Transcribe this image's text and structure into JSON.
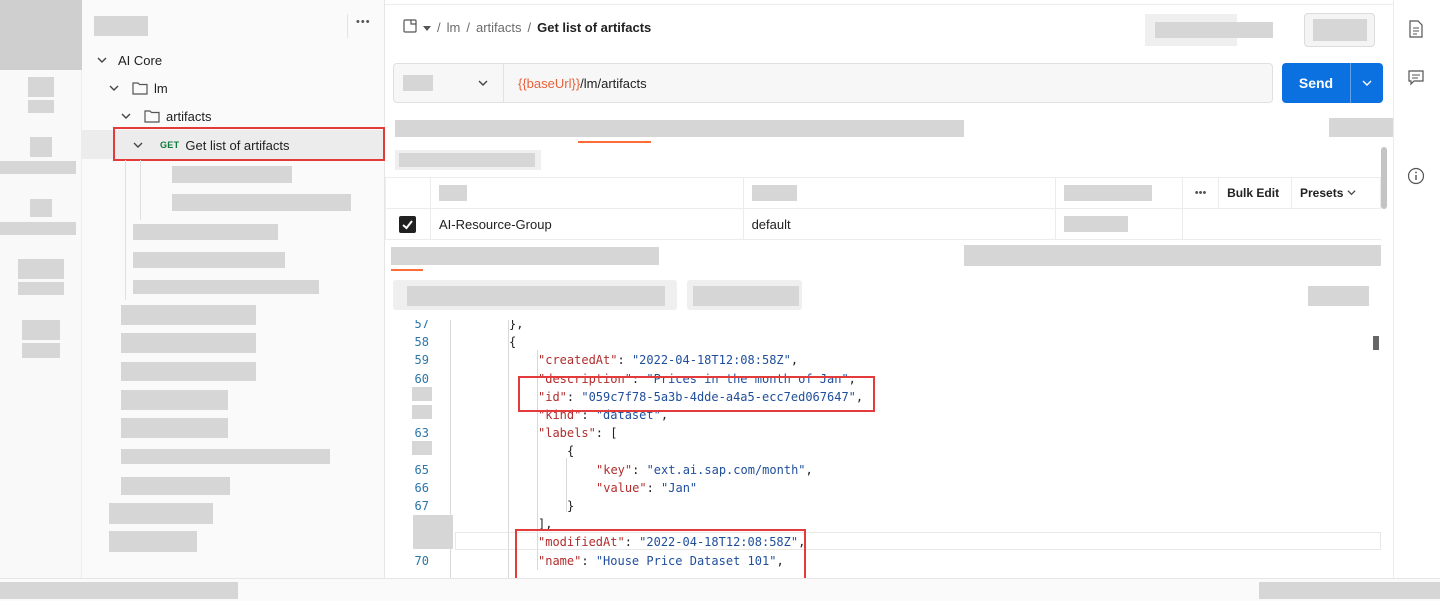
{
  "sidebar": {
    "more_label": "•••",
    "tree": {
      "root": "AI Core",
      "lm": "lm",
      "artifacts": "artifacts",
      "request_method": "GET",
      "request_name": "Get list of artifacts"
    }
  },
  "breadcrumb": {
    "sep": "/",
    "items": [
      "lm",
      "artifacts"
    ],
    "current": "Get list of artifacts"
  },
  "request": {
    "url_var": "{{baseUrl}}",
    "url_path": "/lm/artifacts",
    "send_label": "Send"
  },
  "params_table": {
    "more_label": "•••",
    "bulk_edit_label": "Bulk Edit",
    "presets_label": "Presets",
    "rows": [
      {
        "checked": true,
        "key": "AI-Resource-Group",
        "value": "default"
      }
    ]
  },
  "response_code": [
    {
      "num": "57",
      "indent": 0,
      "parts": [
        [
          "p",
          "},"
        ]
      ]
    },
    {
      "num": "58",
      "indent": 0,
      "parts": [
        [
          "p",
          "{"
        ]
      ]
    },
    {
      "num": "59",
      "indent": 1,
      "parts": [
        [
          "k",
          "\"createdAt\""
        ],
        [
          "p",
          ": "
        ],
        [
          "s",
          "\"2022-04-18T12:08:58Z\""
        ],
        [
          "p",
          ","
        ]
      ]
    },
    {
      "num": "60",
      "indent": 1,
      "parts": [
        [
          "k",
          "\"description\""
        ],
        [
          "p",
          ": "
        ],
        [
          "s",
          "\"Prices in the month of Jan\""
        ],
        [
          "p",
          ","
        ]
      ]
    },
    {
      "num": "",
      "indent": 1,
      "parts": [
        [
          "k",
          "\"id\""
        ],
        [
          "p",
          ": "
        ],
        [
          "s",
          "\"059c7f78-5a3b-4dde-a4a5-ecc7ed067647\""
        ],
        [
          "p",
          ","
        ]
      ]
    },
    {
      "num": "",
      "indent": 1,
      "parts": [
        [
          "k",
          "\"kind\""
        ],
        [
          "p",
          ": "
        ],
        [
          "s",
          "\"dataset\""
        ],
        [
          "p",
          ","
        ]
      ]
    },
    {
      "num": "63",
      "indent": 1,
      "parts": [
        [
          "k",
          "\"labels\""
        ],
        [
          "p",
          ": ["
        ]
      ]
    },
    {
      "num": "",
      "indent": 2,
      "parts": [
        [
          "p",
          "{"
        ]
      ]
    },
    {
      "num": "65",
      "indent": 3,
      "parts": [
        [
          "k",
          "\"key\""
        ],
        [
          "p",
          ": "
        ],
        [
          "s",
          "\"ext.ai.sap.com/month\""
        ],
        [
          "p",
          ","
        ]
      ]
    },
    {
      "num": "66",
      "indent": 3,
      "parts": [
        [
          "k",
          "\"value\""
        ],
        [
          "p",
          ": "
        ],
        [
          "s",
          "\"Jan\""
        ]
      ]
    },
    {
      "num": "67",
      "indent": 2,
      "parts": [
        [
          "p",
          "}"
        ]
      ]
    },
    {
      "num": "",
      "indent": 1,
      "parts": [
        [
          "p",
          "],"
        ]
      ]
    },
    {
      "num": "",
      "indent": 1,
      "parts": [
        [
          "k",
          "\"modifiedAt\""
        ],
        [
          "p",
          ": "
        ],
        [
          "s",
          "\"2022-04-18T12:08:58Z\""
        ],
        [
          "p",
          ","
        ]
      ]
    },
    {
      "num": "70",
      "indent": 1,
      "parts": [
        [
          "k",
          "\"name\""
        ],
        [
          "p",
          ": "
        ],
        [
          "s",
          "\"House Price Dataset 101\""
        ],
        [
          "p",
          ","
        ]
      ]
    }
  ]
}
